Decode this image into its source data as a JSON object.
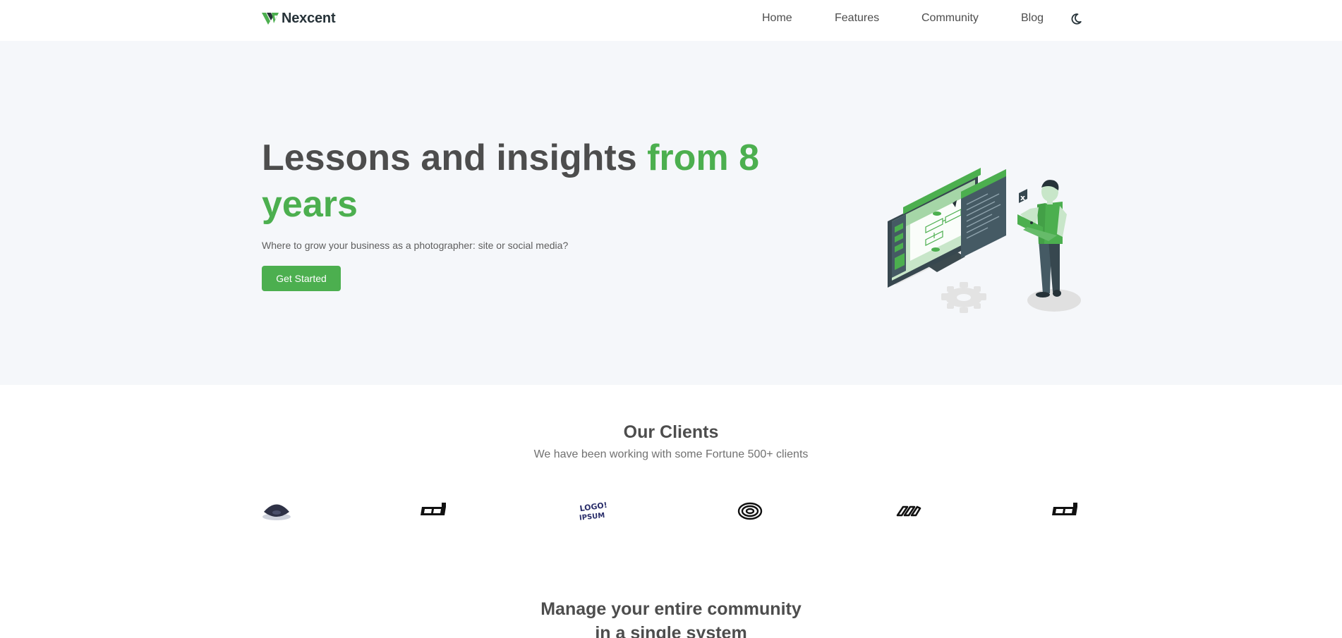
{
  "nav": {
    "brand": "Nexcent",
    "links": [
      {
        "label": "Home"
      },
      {
        "label": "Features"
      },
      {
        "label": "Community"
      },
      {
        "label": "Blog"
      }
    ],
    "theme_icon": "moon-icon"
  },
  "hero": {
    "title_main": "Lessons and insights ",
    "title_accent": "from 8 years",
    "subtitle": "Where to grow your business as a photographer: site or social media?",
    "cta_label": "Get Started",
    "illustration": "developer-at-monitor-illustration"
  },
  "clients": {
    "title": "Our Clients",
    "subtitle": "We have been working with some Fortune 500+ clients",
    "logos": [
      {
        "icon": "client-logo-dome"
      },
      {
        "icon": "client-logo-block"
      },
      {
        "icon": "client-logo-logoipsum",
        "text": "LOGO! IPSUM"
      },
      {
        "icon": "client-logo-rings"
      },
      {
        "icon": "client-logo-chain"
      },
      {
        "icon": "client-logo-block"
      }
    ]
  },
  "manage": {
    "title_line1": "Manage your entire community",
    "title_line2": "in a single system"
  },
  "colors": {
    "accent": "#4caf4f",
    "hero_bg": "#f5f7fa",
    "heading": "#4d4d4d",
    "brand_dark": "#263238"
  }
}
